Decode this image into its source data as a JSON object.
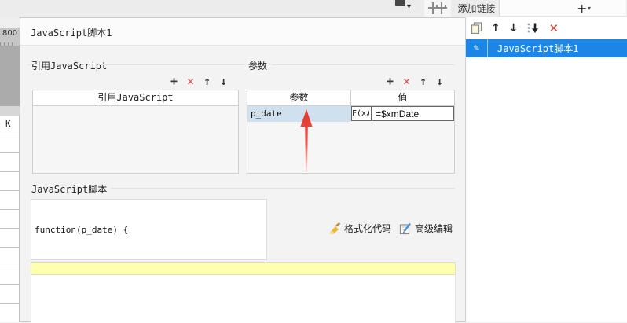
{
  "colors": {
    "accent_blue": "#1b86e6",
    "selected_cell_blue": "#cfe1ee",
    "danger_red": "#e04b4b",
    "highlight_yellow": "#ffffb0"
  },
  "icons": {
    "plus": "+",
    "delete": "✕",
    "up": "↑",
    "down": "↓",
    "dropdown": "▾",
    "pencil": "✎"
  },
  "top_bar": {
    "add_link_tab": "添加链接",
    "add_button": "+"
  },
  "designer": {
    "ruler_label": "800",
    "cell_label": "K"
  },
  "dialog": {
    "title": "JavaScript脚本1",
    "ref_section": {
      "label": "引用JavaScript",
      "table_header": "引用JavaScript"
    },
    "param_section": {
      "label": "参数",
      "col_param": "参数",
      "col_value": "值",
      "row": {
        "name": "p_date",
        "fx_button": "F(x)",
        "value": "=$xmDate"
      }
    },
    "script_section": {
      "label": "JavaScript脚本",
      "code": "function(p_date) {",
      "format_button": "格式化代码",
      "advanced_button": "高级编辑"
    }
  },
  "right_panel": {
    "items": [
      {
        "label": "JavaScript脚本1"
      }
    ]
  }
}
